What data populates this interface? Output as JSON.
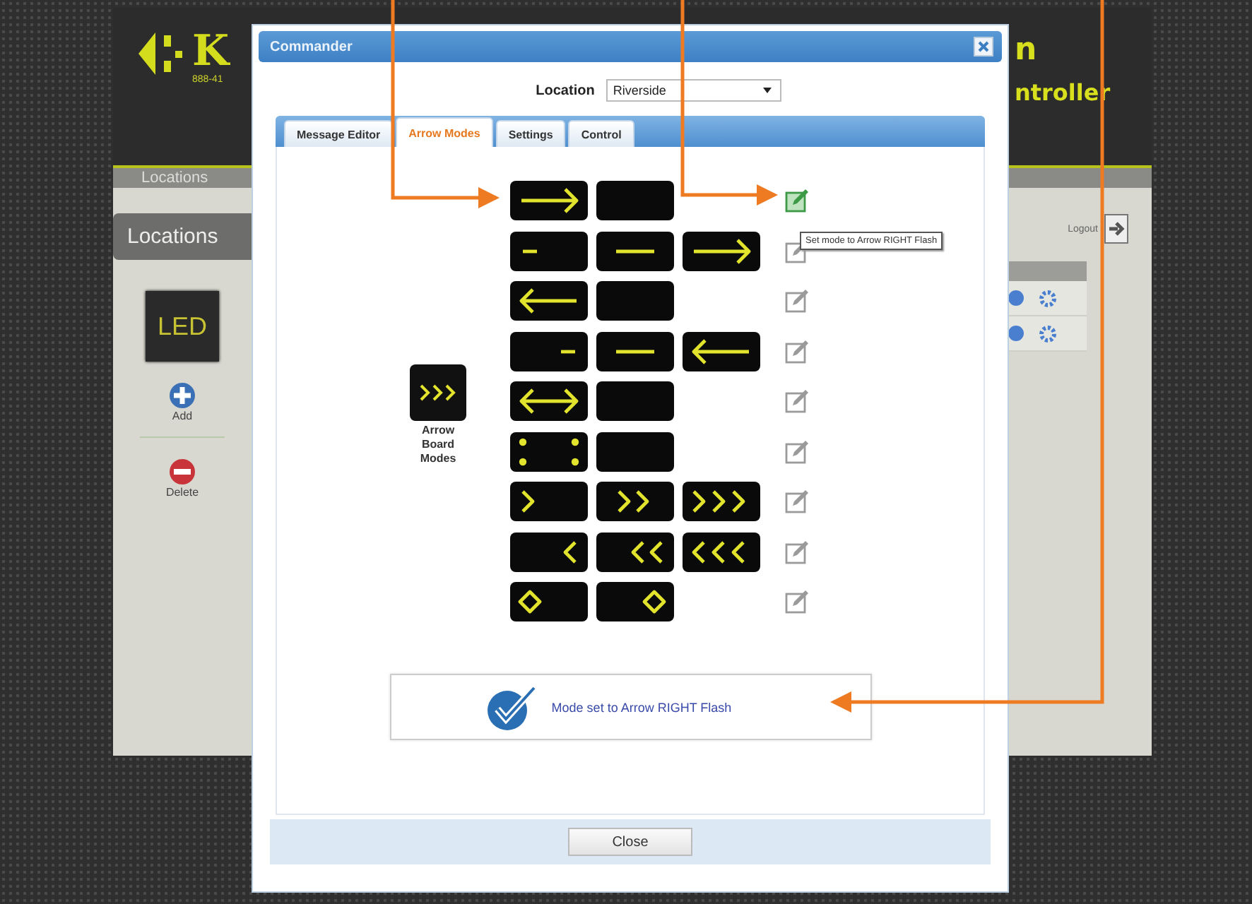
{
  "background_page": {
    "logo_text": "K",
    "phone": "888-41",
    "title_fragments": [
      "n",
      "ntroller"
    ],
    "nav_label": "Locations",
    "sidebar": {
      "heading": "Locations",
      "device_label": "LED",
      "actions": [
        {
          "kind": "add",
          "label": "Add"
        },
        {
          "kind": "delete",
          "label": "Delete"
        }
      ]
    },
    "logout": "Logout"
  },
  "dialog": {
    "title": "Commander",
    "location": {
      "label": "Location",
      "value": "Riverside"
    },
    "tabs": [
      {
        "label": "Message Editor",
        "selected": false
      },
      {
        "label": "Arrow Modes",
        "selected": true
      },
      {
        "label": "Settings",
        "selected": false
      },
      {
        "label": "Control",
        "selected": false
      }
    ],
    "board_label": "Arrow Board Modes",
    "modes": [
      {
        "panels": [
          {
            "kind": "arrow-right"
          },
          {
            "kind": "blank"
          }
        ],
        "active": true
      },
      {
        "panels": [
          {
            "kind": "dash-left"
          },
          {
            "kind": "dash-center"
          },
          {
            "kind": "arrow-right"
          }
        ],
        "active": false
      },
      {
        "panels": [
          {
            "kind": "arrow-left"
          },
          {
            "kind": "blank"
          }
        ],
        "active": false
      },
      {
        "panels": [
          {
            "kind": "dash-right"
          },
          {
            "kind": "dash-center"
          },
          {
            "kind": "arrow-left"
          }
        ],
        "active": false
      },
      {
        "panels": [
          {
            "kind": "double-arrow"
          },
          {
            "kind": "blank"
          }
        ],
        "active": false
      },
      {
        "panels": [
          {
            "kind": "corner-dots"
          },
          {
            "kind": "blank"
          }
        ],
        "active": false
      },
      {
        "panels": [
          {
            "kind": "chevron-right-1"
          },
          {
            "kind": "chevron-right-2"
          },
          {
            "kind": "chevron-right-3"
          }
        ],
        "active": false
      },
      {
        "panels": [
          {
            "kind": "chevron-left-1"
          },
          {
            "kind": "chevron-left-2"
          },
          {
            "kind": "chevron-left-3"
          }
        ],
        "active": false
      },
      {
        "panels": [
          {
            "kind": "diamond-left"
          },
          {
            "kind": "diamond-right"
          }
        ],
        "active": false
      }
    ],
    "tooltip": "Set mode to Arrow RIGHT Flash",
    "status_message": "Mode set to Arrow RIGHT Flash",
    "close_button": "Close"
  }
}
